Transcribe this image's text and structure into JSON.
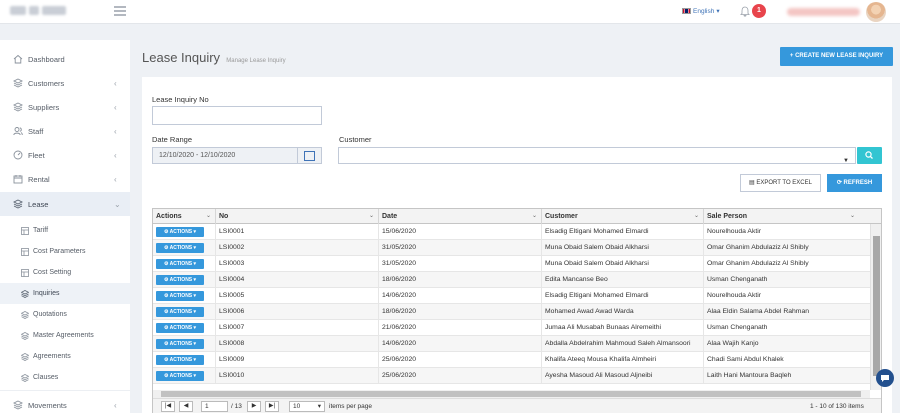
{
  "header": {
    "language": "English",
    "notification_count": "1"
  },
  "sidebar": {
    "items": [
      {
        "label": "Dashboard",
        "icon": "home-icon"
      },
      {
        "label": "Customers",
        "icon": "layers-icon"
      },
      {
        "label": "Suppliers",
        "icon": "layers-icon"
      },
      {
        "label": "Staff",
        "icon": "users-icon"
      },
      {
        "label": "Fleet",
        "icon": "speedometer-icon"
      },
      {
        "label": "Rental",
        "icon": "calendar-icon"
      },
      {
        "label": "Lease",
        "icon": "layers-icon"
      }
    ],
    "lease_submenu": [
      {
        "label": "Tariff"
      },
      {
        "label": "Cost Parameters"
      },
      {
        "label": "Cost Setting"
      },
      {
        "label": "Inquiries"
      },
      {
        "label": "Quotations"
      },
      {
        "label": "Master Agreements"
      },
      {
        "label": "Agreements"
      },
      {
        "label": "Clauses"
      }
    ],
    "movements": "Movements"
  },
  "page": {
    "title": "Lease Inquiry",
    "subtitle": "Manage Lease Inquiry",
    "create_button": "CREATE NEW LEASE INQUIRY"
  },
  "filters": {
    "inquiry_no_label": "Lease Inquiry No",
    "inquiry_no_value": "",
    "date_range_label": "Date Range",
    "date_range_value": "12/10/2020 - 12/10/2020",
    "customer_label": "Customer",
    "customer_value": ""
  },
  "toolbar": {
    "export_label": "EXPORT TO EXCEL",
    "refresh_label": "REFRESH"
  },
  "grid": {
    "columns": [
      "Actions",
      "No",
      "Date",
      "Customer",
      "Sale Person"
    ],
    "action_label": "ACTIONS",
    "rows": [
      {
        "no": "LSI0001",
        "date": "15/06/2020",
        "customer": "Elsadig Eltigani Mohamed Elmardi",
        "sale_person": "Nourelhouda Aktir"
      },
      {
        "no": "LSI0002",
        "date": "31/05/2020",
        "customer": "Muna Obaid Salem Obaid Alkharsi",
        "sale_person": "Omar Ghanim Abdulaziz Al Shibly"
      },
      {
        "no": "LSI0003",
        "date": "31/05/2020",
        "customer": "Muna Obaid Salem Obaid Alkharsi",
        "sale_person": "Omar Ghanim Abdulaziz Al Shibly"
      },
      {
        "no": "LSI0004",
        "date": "18/06/2020",
        "customer": "Edita Mancanse Beo",
        "sale_person": "Usman Chenganath"
      },
      {
        "no": "LSI0005",
        "date": "14/06/2020",
        "customer": "Elsadig Eltigani Mohamed Elmardi",
        "sale_person": "Nourelhouda Aktir"
      },
      {
        "no": "LSI0006",
        "date": "18/06/2020",
        "customer": "Mohamed Awad Awad Warda",
        "sale_person": "Alaa Eldin Salama Abdel Rahman"
      },
      {
        "no": "LSI0007",
        "date": "21/06/2020",
        "customer": "Jumaa Ali Musabah Bunaas Alremeithi",
        "sale_person": "Usman Chenganath"
      },
      {
        "no": "LSI0008",
        "date": "14/06/2020",
        "customer": "Abdalla Abdelrahim Mahmoud Saleh Almansoori",
        "sale_person": "Alaa Wajih Kanjo"
      },
      {
        "no": "LSI0009",
        "date": "25/06/2020",
        "customer": "Khalifa Ateeq Mousa Khalifa Almheiri",
        "sale_person": "Chadi Sami Abdul Khalek"
      },
      {
        "no": "LSI0010",
        "date": "25/06/2020",
        "customer": "Ayesha Masoud Ali Masoud Aljneibi",
        "sale_person": "Laith Hani Mantoura Baqleh"
      }
    ]
  },
  "pager": {
    "page": "1",
    "total_pages": "/ 13",
    "page_size": "10",
    "items_per_page": "items per page",
    "summary": "1 - 10 of 130 items"
  },
  "colors": {
    "primary": "#3598dc",
    "search": "#32c5d2",
    "badge": "#e8444c"
  }
}
